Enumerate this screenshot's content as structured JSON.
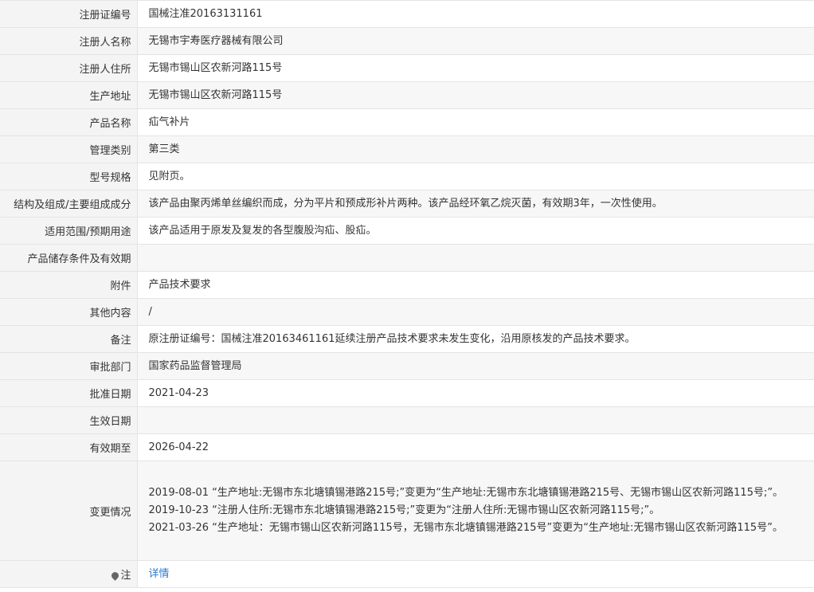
{
  "rows": [
    {
      "label": "注册证编号",
      "value": "国械注准20163131161"
    },
    {
      "label": "注册人名称",
      "value": "无锡市宇寿医疗器械有限公司"
    },
    {
      "label": "注册人住所",
      "value": "无锡市锡山区农新河路115号"
    },
    {
      "label": "生产地址",
      "value": "无锡市锡山区农新河路115号"
    },
    {
      "label": "产品名称",
      "value": "疝气补片"
    },
    {
      "label": "管理类别",
      "value": "第三类"
    },
    {
      "label": "型号规格",
      "value": "见附页。"
    },
    {
      "label": "结构及组成/主要组成成分",
      "value": "该产品由聚丙烯单丝编织而成，分为平片和预成形补片两种。该产品经环氧乙烷灭菌，有效期3年，一次性使用。"
    },
    {
      "label": "适用范围/预期用途",
      "value": "该产品适用于原发及复发的各型腹股沟疝、股疝。"
    },
    {
      "label": "产品储存条件及有效期",
      "value": ""
    },
    {
      "label": "附件",
      "value": "产品技术要求"
    },
    {
      "label": "其他内容",
      "value": "/"
    },
    {
      "label": "备注",
      "value": "原注册证编号：国械注准20163461161延续注册产品技术要求未发生变化，沿用原核发的产品技术要求。"
    },
    {
      "label": "审批部门",
      "value": "国家药品监督管理局"
    },
    {
      "label": "批准日期",
      "value": "2021-04-23"
    },
    {
      "label": "生效日期",
      "value": ""
    },
    {
      "label": "有效期至",
      "value": "2026-04-22"
    }
  ],
  "changes": {
    "label": "变更情况",
    "items": [
      "2019-08-01 “生产地址:无锡市东北塘镇锡港路215号;”变更为“生产地址:无锡市东北塘镇锡港路215号、无锡市锡山区农新河路115号;”。",
      "2019-10-23 “注册人住所:无锡市东北塘镇锡港路215号;”变更为“注册人住所:无锡市锡山区农新河路115号;”。",
      "2021-03-26 “生产地址：无锡市锡山区农新河路115号，无锡市东北塘镇锡港路215号”变更为“生产地址:无锡市锡山区农新河路115号”。"
    ]
  },
  "note": {
    "label": "注",
    "icon": "map-pin-icon",
    "link_text": "详情"
  }
}
